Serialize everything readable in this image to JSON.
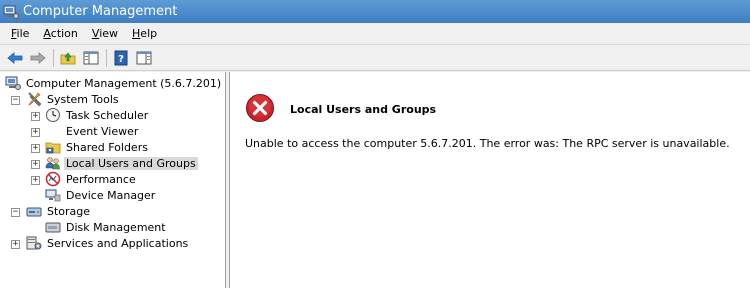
{
  "window": {
    "title": "Computer Management"
  },
  "menubar": {
    "items": [
      {
        "label": "File",
        "accel": "F",
        "rest": "ile"
      },
      {
        "label": "Action",
        "accel": "A",
        "rest": "ction"
      },
      {
        "label": "View",
        "accel": "V",
        "rest": "iew"
      },
      {
        "label": "Help",
        "accel": "H",
        "rest": "elp"
      }
    ]
  },
  "toolbar": {
    "buttons": [
      "back-icon",
      "forward-icon",
      "up-folder-icon",
      "show-hide-tree-icon",
      "help-icon",
      "action-pane-icon"
    ]
  },
  "tree": {
    "root": "Computer Management (5.6.7.201)",
    "system_tools": "System Tools",
    "task_scheduler": "Task Scheduler",
    "event_viewer": "Event Viewer",
    "shared_folders": "Shared Folders",
    "local_users": "Local Users and Groups",
    "performance": "Performance",
    "device_manager": "Device Manager",
    "storage": "Storage",
    "disk_management": "Disk Management",
    "services": "Services and Applications",
    "expand_glyph": "+",
    "collapse_glyph": "−"
  },
  "content": {
    "error_title": "Local Users and Groups",
    "error_message": "Unable to access the computer 5.6.7.201. The error was: The RPC server is unavailable."
  },
  "colors": {
    "titlebar": "#3f7fc2",
    "error_red": "#c8242b",
    "selection": "#d9d9d9"
  }
}
